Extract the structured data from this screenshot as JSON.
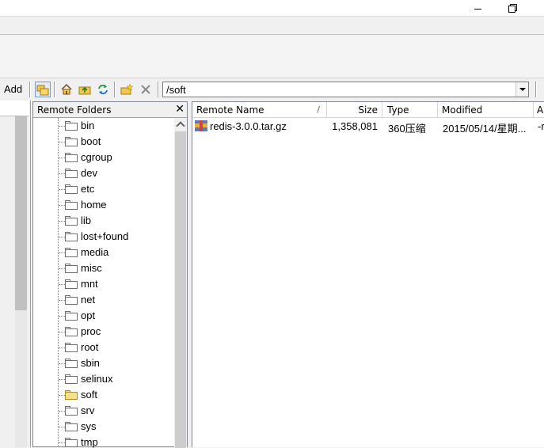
{
  "toolbar": {
    "add_label": "Add",
    "path_value": "/soft",
    "overflow_label": "A"
  },
  "folders_pane": {
    "title": "Remote Folders",
    "close_glyph": "✕",
    "items": [
      {
        "label": "bin",
        "open": false
      },
      {
        "label": "boot",
        "open": false
      },
      {
        "label": "cgroup",
        "open": false
      },
      {
        "label": "dev",
        "open": false
      },
      {
        "label": "etc",
        "open": false
      },
      {
        "label": "home",
        "open": false
      },
      {
        "label": "lib",
        "open": false
      },
      {
        "label": "lost+found",
        "open": false
      },
      {
        "label": "media",
        "open": false
      },
      {
        "label": "misc",
        "open": false
      },
      {
        "label": "mnt",
        "open": false
      },
      {
        "label": "net",
        "open": false
      },
      {
        "label": "opt",
        "open": false
      },
      {
        "label": "proc",
        "open": false
      },
      {
        "label": "root",
        "open": false
      },
      {
        "label": "sbin",
        "open": false
      },
      {
        "label": "selinux",
        "open": false
      },
      {
        "label": "soft",
        "open": true
      },
      {
        "label": "srv",
        "open": false
      },
      {
        "label": "sys",
        "open": false
      },
      {
        "label": "tmp",
        "open": false
      }
    ]
  },
  "files_pane": {
    "columns": {
      "name": "Remote Name",
      "sort_mark": "/",
      "size": "Size",
      "type": "Type",
      "modified": "Modified",
      "attr": "A"
    },
    "rows": [
      {
        "name": "redis-3.0.0.tar.gz",
        "size": "1,358,081",
        "type": "360压缩",
        "modified": "2015/05/14/星期...",
        "attr": "-r"
      }
    ]
  },
  "colors": {
    "accent_selected": "#e4ecf7",
    "open_folder": "#f7e08a"
  }
}
